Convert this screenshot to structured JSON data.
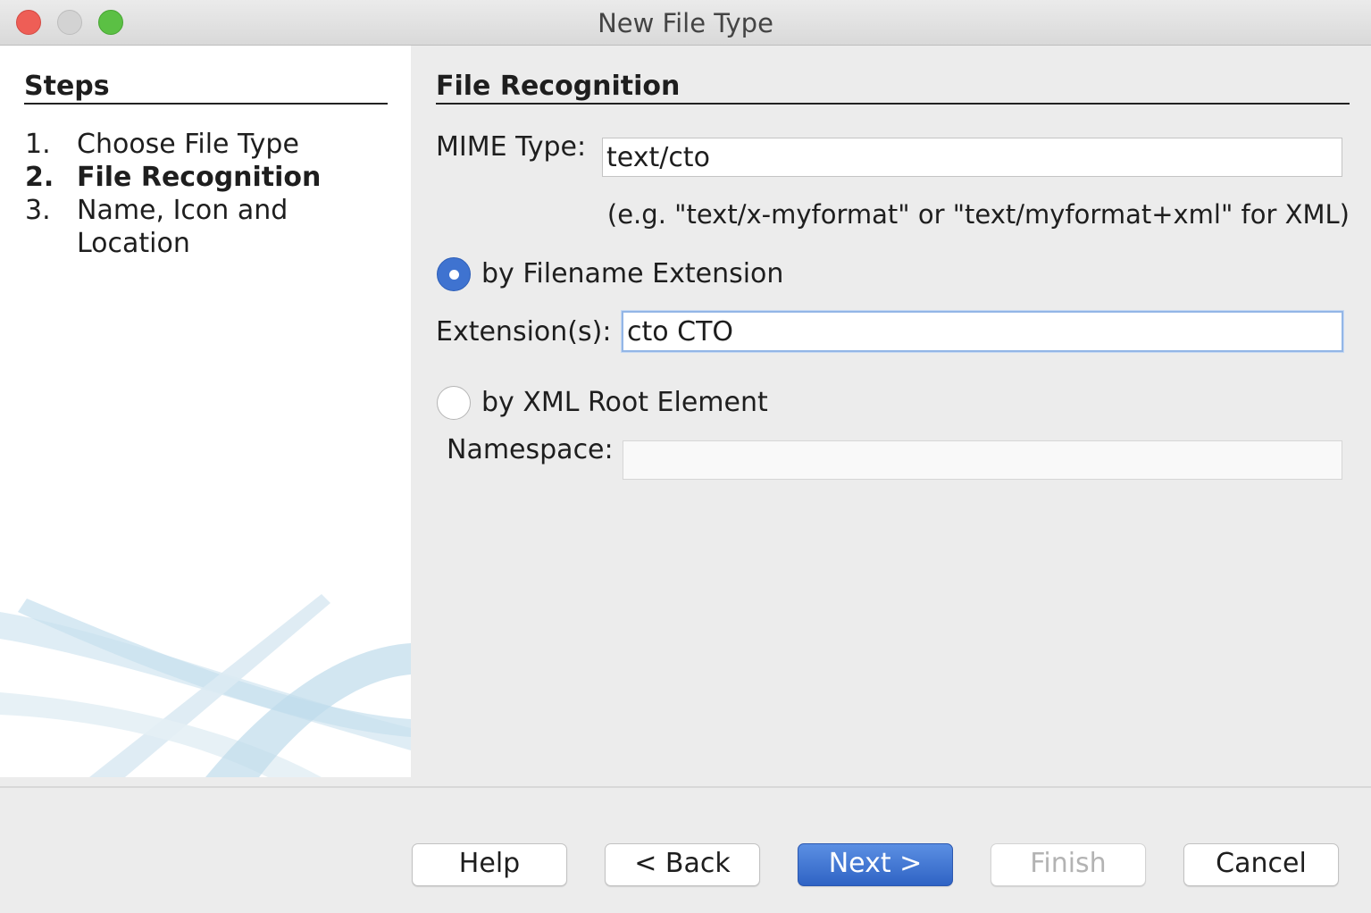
{
  "window": {
    "title": "New File Type"
  },
  "steps": {
    "title": "Steps",
    "items": [
      {
        "num": "1.",
        "label": "Choose File Type",
        "active": false
      },
      {
        "num": "2.",
        "label": "File Recognition",
        "active": true
      },
      {
        "num": "3.",
        "label": "Name, Icon and Location",
        "active": false
      }
    ]
  },
  "main": {
    "title": "File Recognition",
    "mime_label": "MIME Type:",
    "mime_value": "text/cto",
    "mime_hint": "(e.g. \"text/x-myformat\" or \"text/myformat+xml\" for XML)",
    "radio_ext_label": "by Filename Extension",
    "radio_ext_selected": true,
    "ext_label": "Extension(s):",
    "ext_value": "cto CTO",
    "radio_xml_label": "by XML Root Element",
    "radio_xml_selected": false,
    "namespace_label": "Namespace:",
    "namespace_value": ""
  },
  "buttons": {
    "help": "Help",
    "back": "< Back",
    "next": "Next >",
    "finish": "Finish",
    "cancel": "Cancel"
  },
  "colors": {
    "accent": "#3f73d0",
    "panel_bg": "#ececec"
  }
}
